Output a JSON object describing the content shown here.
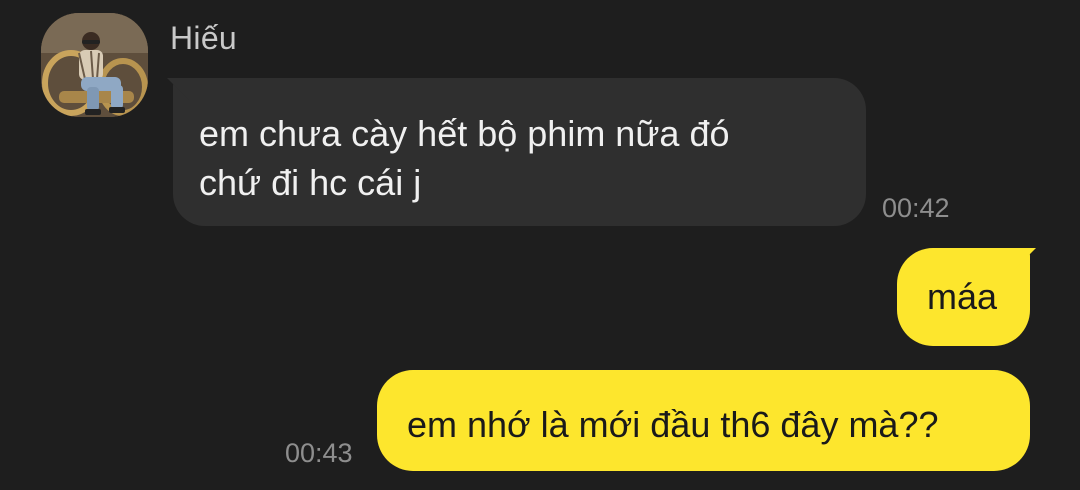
{
  "conversation": {
    "contact": {
      "name": "Hiếu"
    },
    "messages": [
      {
        "direction": "incoming",
        "lines": [
          "em chưa cày hết bộ phim nữa đó",
          "chứ đi hc cái j"
        ],
        "time": "00:42"
      },
      {
        "direction": "outgoing",
        "text": "máa"
      },
      {
        "direction": "outgoing",
        "text": "em nhớ là mới đầu th6 đây mà??",
        "time": "00:43"
      }
    ]
  },
  "colors": {
    "background": "#1e1e1e",
    "incoming_bubble": "#2f2f2f",
    "outgoing_bubble": "#fde62d",
    "timestamp": "#8e8e8e"
  }
}
